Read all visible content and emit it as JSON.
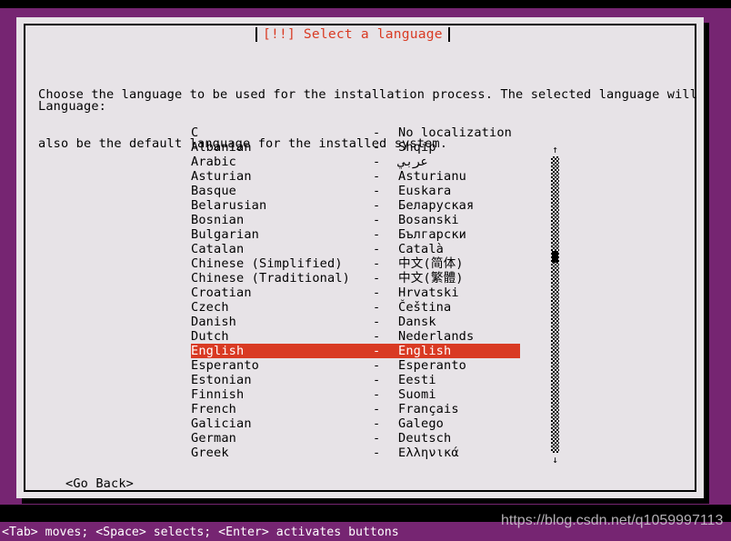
{
  "window": {
    "title": "[!!] Select a language",
    "backdrop_color": "#762572",
    "dialog_bg_color": "#e7e3e7",
    "accent_color": "#d93a23"
  },
  "dialog": {
    "description_line1": "Choose the language to be used for the installation process. The selected language will",
    "description_line2": "also be the default language for the installed system.",
    "field_label": "Language:",
    "go_back_label": "<Go Back>",
    "separator": "-"
  },
  "scrollbar": {
    "up_arrow": "↑",
    "down_arrow": "↓"
  },
  "language_list": {
    "selected_index": 15,
    "items": [
      {
        "name": "C",
        "native": "No localization"
      },
      {
        "name": "Albanian",
        "native": "Shqip"
      },
      {
        "name": "Arabic",
        "native": "عربي"
      },
      {
        "name": "Asturian",
        "native": "Asturianu"
      },
      {
        "name": "Basque",
        "native": "Euskara"
      },
      {
        "name": "Belarusian",
        "native": "Беларуская"
      },
      {
        "name": "Bosnian",
        "native": "Bosanski"
      },
      {
        "name": "Bulgarian",
        "native": "Български"
      },
      {
        "name": "Catalan",
        "native": "Català"
      },
      {
        "name": "Chinese (Simplified)",
        "native": "中文(简体)"
      },
      {
        "name": "Chinese (Traditional)",
        "native": "中文(繁體)"
      },
      {
        "name": "Croatian",
        "native": "Hrvatski"
      },
      {
        "name": "Czech",
        "native": "Čeština"
      },
      {
        "name": "Danish",
        "native": "Dansk"
      },
      {
        "name": "Dutch",
        "native": "Nederlands"
      },
      {
        "name": "English",
        "native": "English"
      },
      {
        "name": "Esperanto",
        "native": "Esperanto"
      },
      {
        "name": "Estonian",
        "native": "Eesti"
      },
      {
        "name": "Finnish",
        "native": "Suomi"
      },
      {
        "name": "French",
        "native": "Français"
      },
      {
        "name": "Galician",
        "native": "Galego"
      },
      {
        "name": "German",
        "native": "Deutsch"
      },
      {
        "name": "Greek",
        "native": "Ελληνικά"
      }
    ]
  },
  "footer": {
    "help_text": "<Tab> moves; <Space> selects; <Enter> activates buttons"
  },
  "watermark": {
    "text": "https://blog.csdn.net/q1059997113"
  }
}
